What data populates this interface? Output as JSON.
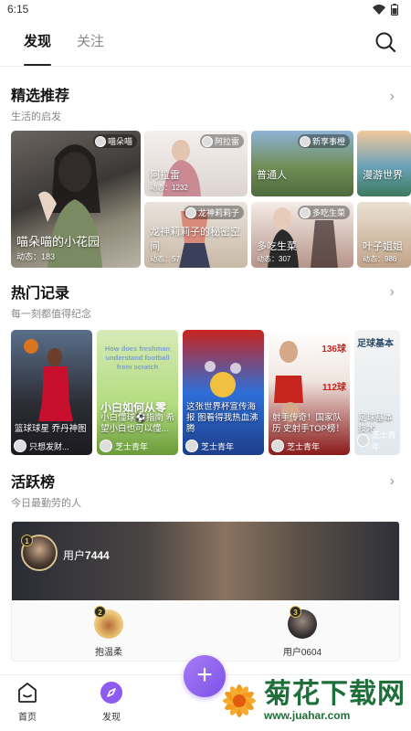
{
  "status": {
    "time": "6:15"
  },
  "nav": {
    "tabs": [
      "发现",
      "关注"
    ]
  },
  "picks": {
    "title": "精选推荐",
    "subtitle": "生活的启发",
    "cards": [
      {
        "tag": "喵朵喵",
        "caption": "喵朵喵的小花园",
        "count": "动态：183"
      },
      {
        "tag": "阿拉雷",
        "caption": "阿拉雷",
        "count": "动态：1232"
      },
      {
        "tag": "新享事橙",
        "caption": "普通人",
        "count": ""
      },
      {
        "tag": "",
        "caption": "漫游世界",
        "count": ""
      },
      {
        "tag": "龙神莉莉子",
        "caption": "龙神莉莉子的秘密空间",
        "count": "动态：57"
      },
      {
        "tag": "多吃生菜",
        "caption": "多吃生菜",
        "count": "动态：307"
      },
      {
        "tag": "",
        "caption": "叶子姐姐",
        "count": "动态：986"
      }
    ]
  },
  "hot": {
    "title": "热门记录",
    "subtitle": "每一刻都值得纪念",
    "cards": [
      {
        "caption": "篮球球星 乔丹神图",
        "author": "只想发财..."
      },
      {
        "caption": "小白懂球⚽指南 希望小白也可以懂...",
        "author": "芝士青年",
        "overlay": "How does freshman understand football from scratch",
        "big": "小白如何从零"
      },
      {
        "caption": "这张世界杯宣传海报 图看得我热血沸腾",
        "author": "芝士青年"
      },
      {
        "caption": "射手传奇！国家队历 史射手TOP榜！",
        "author": "芝士青年",
        "labels": [
          "136球",
          "112球"
        ]
      },
      {
        "caption": "足球基本 技术",
        "author": "芝士青年",
        "big": "足球基本"
      }
    ]
  },
  "active": {
    "title": "活跃榜",
    "subtitle": "今日最勤劳的人",
    "first": {
      "rank": "1",
      "name_prefix": "用户",
      "name_num": "7444"
    },
    "others": [
      {
        "rank": "2",
        "name": "抱温柔"
      },
      {
        "rank": "3",
        "name": "用户0604"
      }
    ]
  },
  "bottom": {
    "home": "首页",
    "discover": "发现",
    "add": "+"
  },
  "watermark": {
    "cn": "菊花下载网",
    "url": "www.juahar.com"
  }
}
